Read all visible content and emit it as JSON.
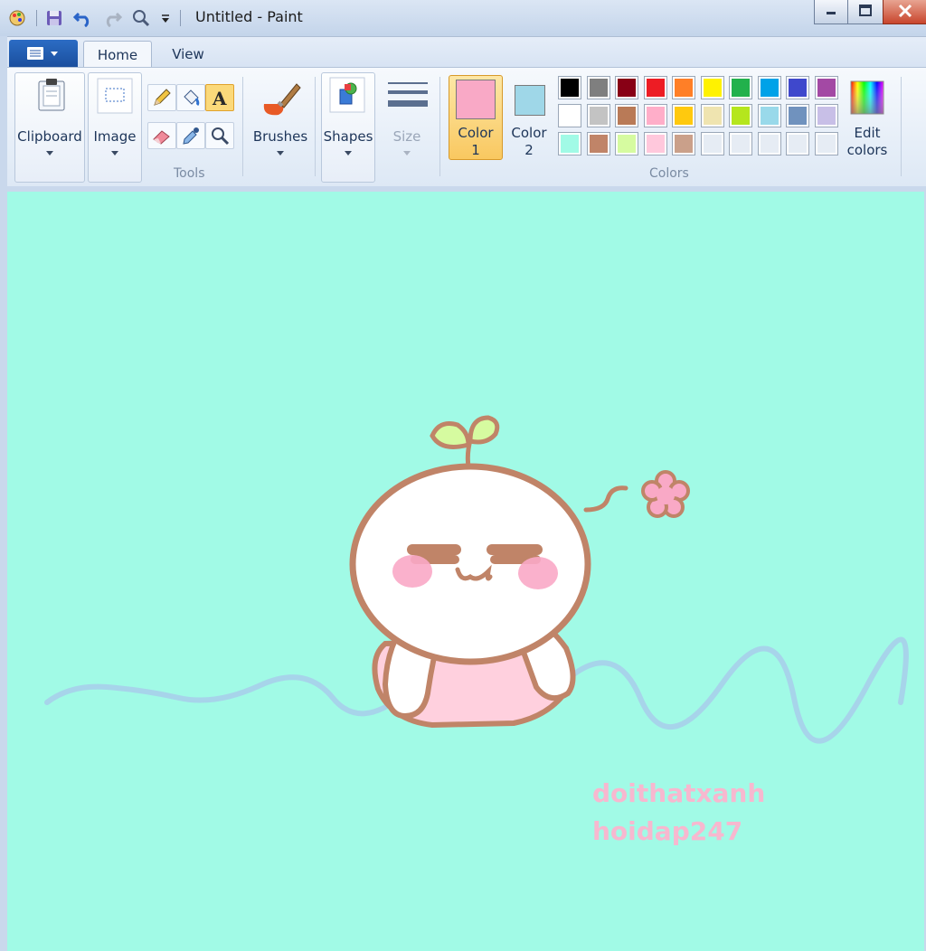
{
  "window": {
    "title": "Untitled - Paint"
  },
  "tabs": [
    {
      "label": "Home"
    },
    {
      "label": "View"
    }
  ],
  "ribbon": {
    "clipboard_label": "Clipboard",
    "image_label": "Image",
    "tools_label": "Tools",
    "brushes_label": "Brushes",
    "shapes_label": "Shapes",
    "size_label": "Size",
    "color1_label": "Color 1",
    "color1_l1": "Color",
    "color1_l2": "1",
    "color2_l1": "Color",
    "color2_l2": "2",
    "colors_label": "Colors",
    "edit_l1": "Edit",
    "edit_l2": "colors",
    "color1_value": "#f9a9c6",
    "color2_value": "#9fd7e8",
    "palette_row1": [
      "#000000",
      "#7f7f7f",
      "#880015",
      "#ed1c24",
      "#ff7f27",
      "#fff200",
      "#22b14c",
      "#00a2e8",
      "#3f48cc",
      "#a349a4"
    ],
    "palette_row2": [
      "#ffffff",
      "#c3c3c3",
      "#b97a57",
      "#ffaec9",
      "#ffc90e",
      "#efe4b0",
      "#b5e61d",
      "#99d9ea",
      "#7092be",
      "#c8bfe7"
    ],
    "palette_row3": [
      "#a1fae6",
      "#c08468",
      "#d6fba0",
      "#ffc8dc",
      "#caa08a",
      "#e6ecf4",
      "#e6ecf4",
      "#e6ecf4",
      "#e6ecf4",
      "#e6ecf4"
    ]
  },
  "canvas": {
    "background": "#a1fae6",
    "watermark_line1": "doithatxanh",
    "watermark_line2": "hoidap247"
  }
}
